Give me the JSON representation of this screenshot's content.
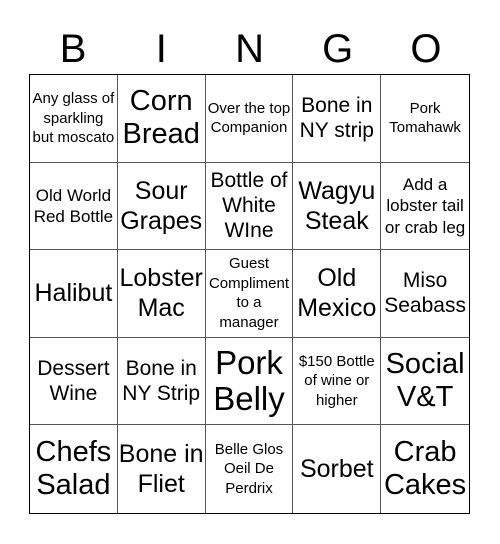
{
  "header": [
    "B",
    "I",
    "N",
    "G",
    "O"
  ],
  "cells": [
    "Any glass of sparkling but moscato",
    "Corn Bread",
    "Over the top Companion",
    "Bone in NY strip",
    "Pork Tomahawk",
    "Old World Red Bottle",
    "Sour Grapes",
    "Bottle of White WIne",
    "Wagyu Steak",
    "Add a lobster tail or crab leg",
    "Halibut",
    "Lobster Mac",
    "Guest Compliment to a manager",
    "Old Mexico",
    "Miso Seabass",
    "Dessert Wine",
    "Bone in NY Strip",
    "Pork Belly",
    "$150 Bottle of wine or higher",
    "Social V&T",
    "Chefs Salad",
    "Bone in Fliet",
    "Belle Glos Oeil De Perdrix",
    "Sorbet",
    "Crab Cakes"
  ]
}
